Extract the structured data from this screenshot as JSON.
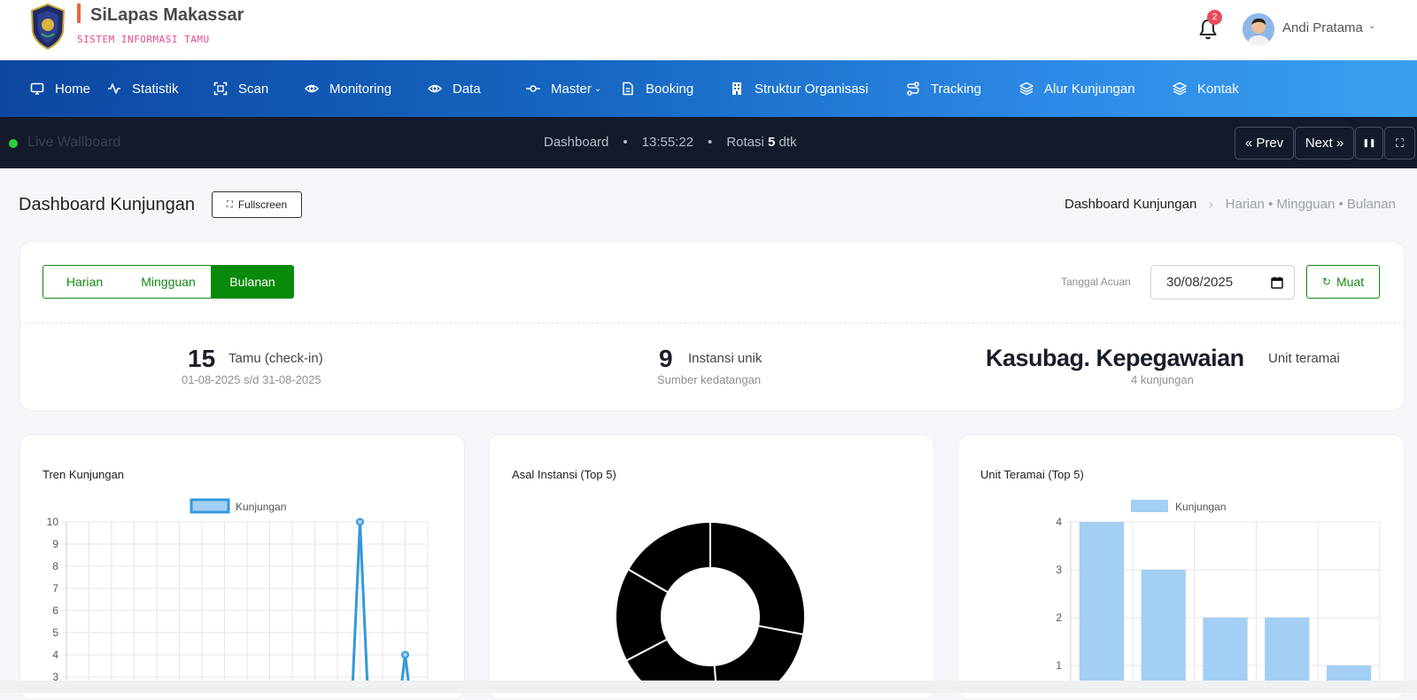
{
  "app": {
    "title": "SiLapas Makassar",
    "subtitle": "SISTEM INFORMASI TAMU",
    "notification_count": "2",
    "user_name": "Andi Pratama",
    "user_chevron": "⌄"
  },
  "nav": {
    "items": [
      {
        "label": "Home",
        "icon": "monitor-icon"
      },
      {
        "label": "Statistik",
        "icon": "activity-icon"
      },
      {
        "label": "Scan",
        "icon": "scan-icon"
      },
      {
        "label": "Monitoring",
        "icon": "eye-icon"
      },
      {
        "label": "Data",
        "icon": "eye-icon"
      },
      {
        "label": "Master",
        "icon": "commit-icon"
      },
      {
        "label": "Booking",
        "icon": "file-icon"
      },
      {
        "label": "Struktur Organisasi",
        "icon": "building-icon"
      },
      {
        "label": "Tracking",
        "icon": "route-icon"
      },
      {
        "label": "Alur Kunjungan",
        "icon": "layers-icon"
      },
      {
        "label": "Kontak",
        "icon": "layers-icon"
      }
    ],
    "master_chevron": "⌄"
  },
  "wallboard": {
    "live_label": "Live Wallboard",
    "page": "Dashboard",
    "separator": "•",
    "time": "13:55:22",
    "rotation_prefix": "Rotasi",
    "rotation_value": "5",
    "rotation_unit": "dtk",
    "prev_label": "« Prev",
    "next_label": "Next »",
    "pause_icon": "❚❚",
    "expand_icon": "⛶"
  },
  "header": {
    "title": "Dashboard Kunjungan",
    "fullscreen_label": "Fullscreen",
    "breadcrumb_current": "Dashboard Kunjungan",
    "breadcrumb_arrow": "›",
    "breadcrumb_rest": "Harian • Mingguan • Bulanan"
  },
  "filter": {
    "periods": [
      "Harian",
      "Mingguan",
      "Bulanan"
    ],
    "active_period": "Bulanan",
    "ref_label": "Tanggal Acuan",
    "date_value": "30/08/2025",
    "load_label": "Muat",
    "load_icon": "↻"
  },
  "stats": [
    {
      "value": "15",
      "label": "Tamu (check-in)",
      "sub": "01-08-2025 s/d 31-08-2025"
    },
    {
      "value": "9",
      "label": "Instansi unik",
      "sub": "Sumber kedatangan"
    },
    {
      "value": "Kasubag. Kepegawaian",
      "label": "Unit teramai",
      "sub": "4 kunjungan"
    }
  ],
  "chart_data": [
    {
      "type": "line",
      "title": "Tren Kunjungan",
      "series": [
        {
          "name": "Kunjungan"
        }
      ],
      "ylim": [
        0,
        10
      ],
      "y_ticks_visible": [
        "10",
        "9",
        "8",
        "7",
        "6",
        "5",
        "4",
        "3"
      ],
      "visible_points": [
        {
          "x_index": 13,
          "y": 10
        },
        {
          "x_index": 15,
          "y": 4
        }
      ],
      "grid": true,
      "legend": "top",
      "color": "#3498db"
    },
    {
      "type": "pie",
      "title": "Asal Instansi (Top 5)",
      "donut": true,
      "slice_values": [
        4.2,
        3.1,
        2.8,
        2.4,
        2.5
      ],
      "color": "#000000"
    },
    {
      "type": "bar",
      "title": "Unit Teramai (Top 5)",
      "series": [
        {
          "name": "Kunjungan",
          "values": [
            4,
            3,
            2,
            2,
            1
          ]
        }
      ],
      "ylim": [
        0,
        4
      ],
      "y_ticks_visible": [
        "4",
        "3",
        "2",
        "1"
      ],
      "grid": true,
      "legend": "top",
      "color": "#a3cff4"
    }
  ]
}
